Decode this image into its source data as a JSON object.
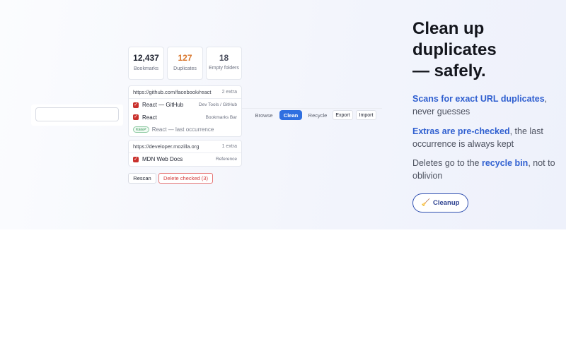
{
  "search": {
    "placeholder": ""
  },
  "stats": [
    {
      "value": "12,437",
      "label": "Bookmarks"
    },
    {
      "value": "127",
      "label": "Duplicates"
    },
    {
      "value": "18",
      "label": "Empty folders"
    }
  ],
  "groups": [
    {
      "url": "https://github.com/facebook/react",
      "extra": "2 extra",
      "rows": [
        {
          "title": "React — GitHub",
          "folder": "Dev Tools / GitHub",
          "checked": true
        },
        {
          "title": "React",
          "folder": "Bookmarks Bar",
          "checked": true
        }
      ],
      "keep": {
        "badge": "KEEP",
        "title": "React — last occurrence"
      }
    },
    {
      "url": "https://developer.mozilla.org",
      "extra": "1 extra",
      "rows": [
        {
          "title": "MDN Web Docs",
          "folder": "Reference",
          "checked": true
        }
      ]
    }
  ],
  "actions": {
    "rescan": "Rescan",
    "delete": "Delete checked (3)"
  },
  "tabs": {
    "browse": "Browse",
    "clean": "Clean",
    "recycle": "Recycle",
    "export": "Export",
    "import": "Import"
  },
  "headline": {
    "line1": "Clean up",
    "line2": "duplicates",
    "line3": "— safely."
  },
  "features": [
    {
      "bold": "Scans for exact URL duplicates",
      "rest": ", never guesses"
    },
    {
      "bold": "Extras are pre-checked",
      "rest": ", the last occurrence is always kept"
    },
    {
      "pre": "Deletes go to the ",
      "bold": "recycle bin",
      "rest": ", not to oblivion"
    }
  ],
  "cta": {
    "icon": "🧹",
    "label": "Cleanup"
  },
  "colors": {
    "accent": "#2f6fe0",
    "duplicate": "#d9772e",
    "danger": "#d23a3a",
    "check": "#c9302c",
    "keep": "#3f9a5f"
  }
}
